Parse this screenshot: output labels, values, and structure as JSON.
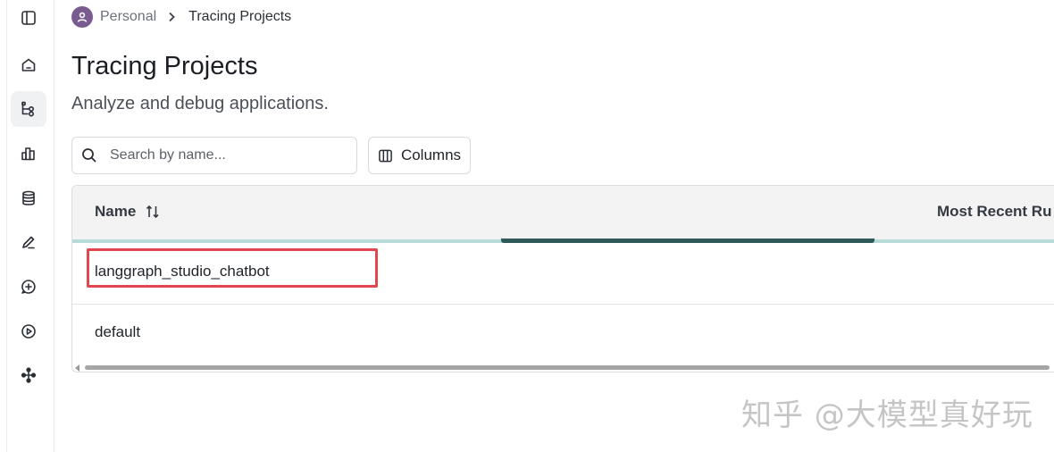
{
  "breadcrumb": {
    "workspace": "Personal",
    "current": "Tracing Projects"
  },
  "page": {
    "title": "Tracing Projects",
    "subtitle": "Analyze and debug applications."
  },
  "search": {
    "placeholder": "Search by name..."
  },
  "toolbar": {
    "columns_label": "Columns"
  },
  "table": {
    "columns": [
      "Name",
      "Most Recent Ru"
    ],
    "rows": [
      {
        "name": "langgraph_studio_chatbot",
        "highlighted": true
      },
      {
        "name": "default",
        "highlighted": false
      }
    ]
  },
  "sidebar": {
    "items": [
      {
        "icon": "sidebar-toggle-icon"
      },
      {
        "icon": "home-icon"
      },
      {
        "icon": "tracing-projects-icon",
        "active": true
      },
      {
        "icon": "monitoring-chart-icon"
      },
      {
        "icon": "datasets-database-icon"
      },
      {
        "icon": "annotation-pen-icon"
      },
      {
        "icon": "prompts-chat-icon"
      },
      {
        "icon": "playground-play-icon"
      },
      {
        "icon": "deployments-network-icon"
      }
    ]
  },
  "watermark": "知乎 @大模型真好玩",
  "colors": {
    "highlight_border": "#e0474f",
    "teal_divider": "#b7dbd6",
    "resize_bar": "#2f5a5a",
    "avatar_bg": "#7a5b8f"
  }
}
